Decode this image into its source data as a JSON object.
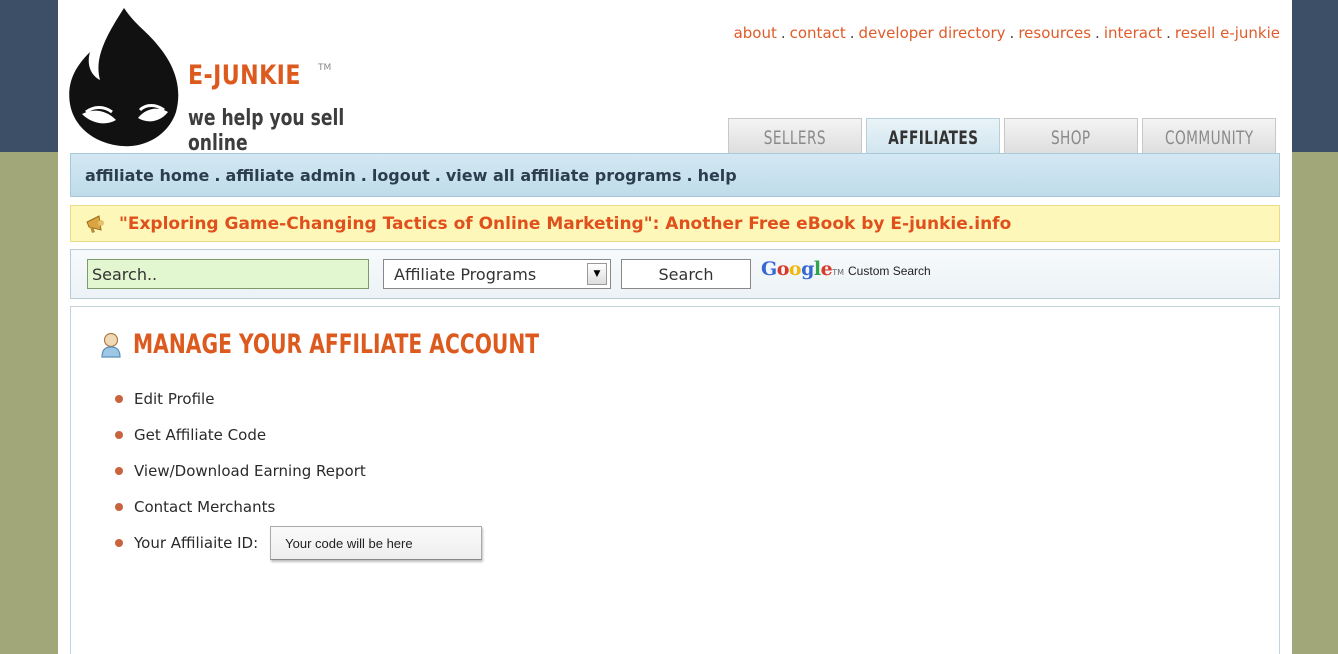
{
  "brand": {
    "name": "E-JUNKIE",
    "trademark": "TM",
    "tagline": "we help you sell online",
    "color": "#dd5a1e"
  },
  "top_links": [
    "about",
    "contact",
    "developer directory",
    "resources",
    "interact",
    "resell e-junkie"
  ],
  "top_link_separator": ".",
  "tabs": [
    {
      "label": "SELLERS",
      "active": false
    },
    {
      "label": "AFFILIATES",
      "active": true
    },
    {
      "label": "SHOP",
      "active": false
    },
    {
      "label": "COMMUNITY",
      "active": false
    }
  ],
  "nav": {
    "items": [
      "affiliate home",
      "affiliate admin",
      "logout",
      "view all affiliate programs",
      "help"
    ],
    "separator": "."
  },
  "promo": {
    "text": "\"Exploring Game-Changing Tactics of Online Marketing\": Another Free eBook by E-junkie.info",
    "icon": "megaphone-icon"
  },
  "search": {
    "placeholder": "Search..",
    "scope_selected": "Affiliate Programs",
    "button_label": "Search",
    "google_word": "Google",
    "google_tm": "TM",
    "custom_search_label": "Custom Search"
  },
  "manage": {
    "heading": "MANAGE YOUR AFFILIATE ACCOUNT",
    "icon": "user-icon",
    "items": [
      "Edit Profile",
      "Get Affiliate Code",
      "View/Download Earning Report",
      "Contact Merchants"
    ],
    "affiliate_id_label": "Your Affiliaite ID:",
    "affiliate_id_value": "Your code will be here"
  },
  "colors": {
    "accent_orange": "#dd5a1e",
    "header_band": "#3d4f66",
    "side_band": "#a1a779",
    "nav_blue": "#c9e2ef",
    "promo_yellow": "#fdf8b9"
  }
}
